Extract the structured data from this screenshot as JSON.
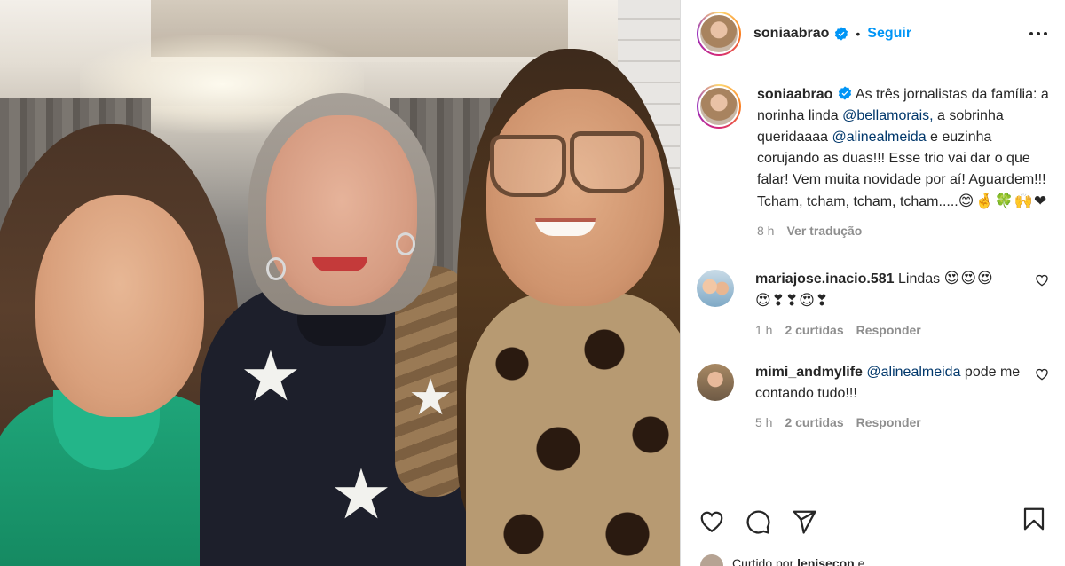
{
  "header": {
    "username": "soniaabrao",
    "separator": "•",
    "follow_label": "Seguir"
  },
  "caption": {
    "username": "soniaabrao",
    "text_1": "As três jornalistas da família: a norinha linda ",
    "mention_1": "@bellamorais,",
    "text_2": " a sobrinha queridaaaa ",
    "mention_2": "@alinealmeida",
    "text_3": " e euzinha corujando as duas!!! Esse trio vai dar o que falar! Vem muita novidade por aí! Aguardem!!! Tcham, tcham, tcham, tcham.....",
    "emojis": "😊🤞🍀🙌❤",
    "time": "8 h",
    "translate_label": "Ver tradução"
  },
  "comments": [
    {
      "username": "mariajose.inacio.581",
      "text": "Lindas",
      "emojis": "😍😍😍😍❣❣😍❣",
      "time": "1 h",
      "likes_label": "2 curtidas",
      "reply_label": "Responder"
    },
    {
      "username": "mimi_andmylife",
      "mention": "@alinealmeida",
      "text": "pode me contando tudo!!!",
      "time": "5 h",
      "likes_label": "2 curtidas",
      "reply_label": "Responder"
    }
  ],
  "likes": {
    "prefix": "Curtido por ",
    "user": "lenisecon",
    "suffix": " e"
  },
  "icons": {
    "verified": "verified-badge-icon",
    "more": "more-options-icon",
    "like": "heart-icon",
    "comment": "comment-icon",
    "share": "share-icon",
    "save": "bookmark-icon"
  },
  "colors": {
    "accent": "#0095f6",
    "mention": "#00376b",
    "muted": "#8e8e8e",
    "text": "#262626"
  }
}
